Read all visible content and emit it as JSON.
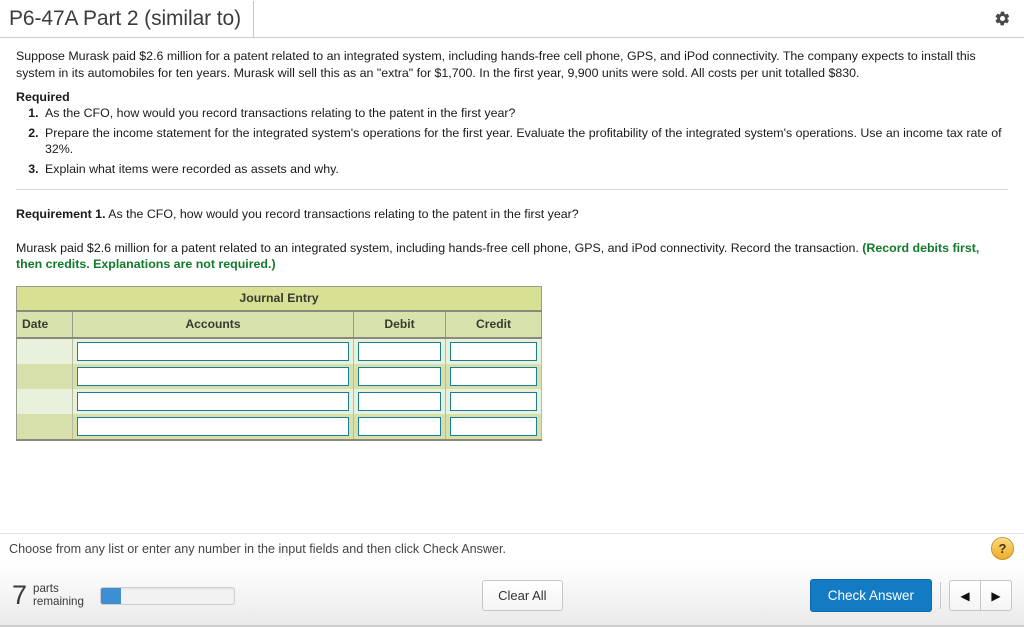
{
  "titlebar": {
    "title": "P6-47A Part 2 (similar to)",
    "gear_icon": "gear-icon"
  },
  "problem": {
    "statement": "Suppose Murask paid $2.6 million for a patent related to an integrated system, including hands-free cell phone, GPS, and iPod connectivity. The company expects to install this system in its automobiles for ten years. Murask will sell this as an \"extra\" for $1,700. In the first year, 9,900 units were sold. All costs per unit totalled $830.",
    "required_heading": "Required",
    "required_items": [
      "As the CFO, how would you record transactions relating to the patent in the first year?",
      "Prepare the income statement for the integrated system's operations for the first year. Evaluate the profitability of the integrated system's operations. Use an income tax rate of 32%.",
      "Explain what items were recorded as assets and why."
    ]
  },
  "requirement": {
    "label": "Requirement 1.",
    "question": "As the CFO, how would you record transactions relating to the patent in the first year?",
    "instruction_plain": "Murask paid $2.6 million for a patent related to an integrated system, including hands-free cell phone, GPS, and iPod connectivity. Record the transaction.",
    "instruction_highlight": "(Record debits first, then credits. Explanations are not required.)"
  },
  "journal": {
    "title": "Journal Entry",
    "columns": [
      "Date",
      "Accounts",
      "Debit",
      "Credit"
    ],
    "rows": [
      {
        "date": "",
        "accounts": "",
        "debit": "",
        "credit": ""
      },
      {
        "date": "",
        "accounts": "",
        "debit": "",
        "credit": ""
      },
      {
        "date": "",
        "accounts": "",
        "debit": "",
        "credit": ""
      },
      {
        "date": "",
        "accounts": "",
        "debit": "",
        "credit": ""
      }
    ],
    "colors": {
      "title_bg": "#d8e093",
      "header_bg": "#d7e2ac",
      "row_odd_bg": "#e8f1dc",
      "row_even_bg": "#d7e0ab",
      "input_border": "#1a7d97"
    }
  },
  "status": {
    "message": "Choose from any list or enter any number in the input fields and then click Check Answer.",
    "help_icon_label": "?"
  },
  "footer": {
    "parts_count": "7",
    "parts_label_line1": "parts",
    "parts_label_line2": "remaining",
    "progress_percent": 15,
    "progress_color": "#3d8fd1",
    "clear_all_label": "Clear All",
    "check_answer_label": "Check Answer",
    "prev_icon": "◀",
    "next_icon": "▶"
  }
}
